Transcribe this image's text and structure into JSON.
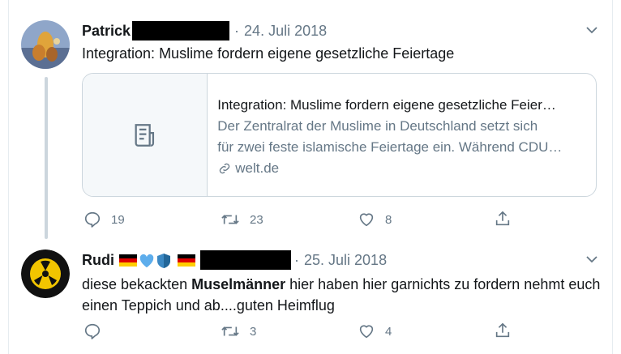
{
  "tweets": [
    {
      "author": "Patrick",
      "date": "24. Juli 2018",
      "text": "Integration: Muslime fordern eigene gesetzliche Feiertage",
      "card": {
        "title": "Integration: Muslime fordern eigene gesetzliche Feier…",
        "desc_line1": "Der Zentralrat der Muslime in Deutschland setzt sich",
        "desc_line2": "für zwei feste islamische Feiertage ein. Während CDU…",
        "domain": "welt.de"
      },
      "actions": {
        "replies": "19",
        "retweets": "23",
        "likes": "8"
      }
    },
    {
      "author": "Rudi",
      "date": "25. Juli 2018",
      "text_before": "diese bekackten ",
      "text_bold": "Muselmänner",
      "text_after": " hier haben hier garnichts zu fordern nehmt euch",
      "text_line2": "einen Teppich und ab....guten Heimflug",
      "actions": {
        "replies": "",
        "retweets": "3",
        "likes": "4"
      }
    }
  ],
  "meta_separator": "·",
  "colors": {
    "text": "#14171a",
    "secondary": "#657786",
    "border": "#ccd6dd"
  }
}
